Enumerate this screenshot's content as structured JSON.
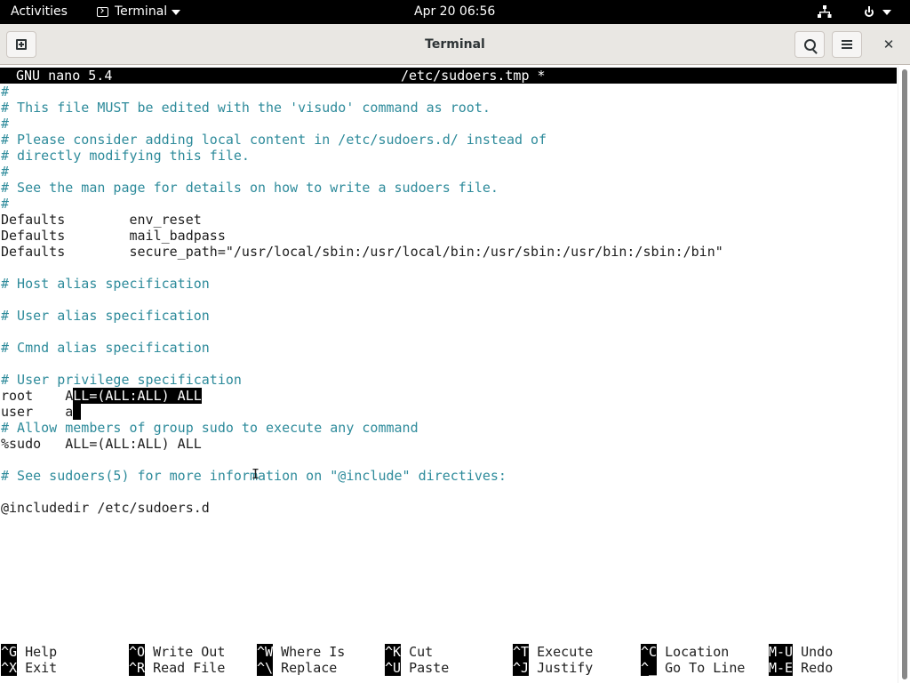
{
  "topbar": {
    "activities": "Activities",
    "app_name": "Terminal",
    "clock": "Apr 20  06:56"
  },
  "window": {
    "title": "Terminal"
  },
  "nano": {
    "version": "GNU nano 5.4",
    "filename": "/etc/sudoers.tmp *",
    "lines": [
      "#",
      "# This file MUST be edited with the 'visudo' command as root.",
      "#",
      "# Please consider adding local content in /etc/sudoers.d/ instead of",
      "# directly modifying this file.",
      "#",
      "# See the man page for details on how to write a sudoers file.",
      "#",
      "Defaults        env_reset",
      "Defaults        mail_badpass",
      "Defaults        secure_path=\"/usr/local/sbin:/usr/local/bin:/usr/sbin:/usr/bin:/sbin:/bin\"",
      "",
      "# Host alias specification",
      "",
      "# User alias specification",
      "",
      "# Cmnd alias specification",
      "",
      "# User privilege specification",
      "root    A",
      "LL=(ALL:ALL) ALL",
      "user    a",
      "# Allow members of group sudo to execute any command",
      "%sudo   ALL=(ALL:ALL) ALL",
      "",
      "# See sudoers(5) for more information on \"@include\" directives:",
      "",
      "@includedir /etc/sudoers.d"
    ],
    "shortcuts": [
      {
        "key": "^G",
        "label": "Help"
      },
      {
        "key": "^X",
        "label": "Exit"
      },
      {
        "key": "^O",
        "label": "Write Out"
      },
      {
        "key": "^R",
        "label": "Read File"
      },
      {
        "key": "^W",
        "label": "Where Is"
      },
      {
        "key": "^\\",
        "label": "Replace"
      },
      {
        "key": "^K",
        "label": "Cut"
      },
      {
        "key": "^U",
        "label": "Paste"
      },
      {
        "key": "^T",
        "label": "Execute"
      },
      {
        "key": "^J",
        "label": "Justify"
      },
      {
        "key": "^C",
        "label": "Location"
      },
      {
        "key": "^_",
        "label": "Go To Line"
      },
      {
        "key": "M-U",
        "label": "Undo"
      },
      {
        "key": "M-E",
        "label": "Redo"
      }
    ]
  },
  "icons": {
    "network": "network-wired-icon",
    "power": "power-icon",
    "new_tab": "new-tab-icon",
    "search": "search-icon",
    "menu": "hamburger-menu-icon",
    "close": "close-icon"
  }
}
